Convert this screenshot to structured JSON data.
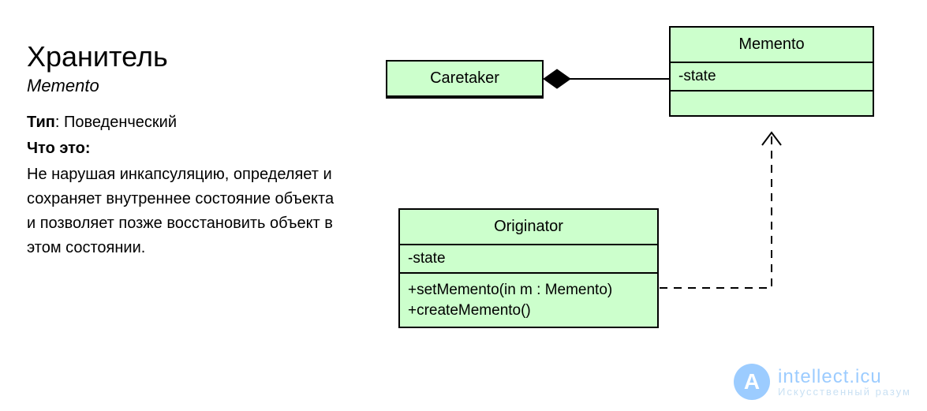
{
  "text": {
    "title": "Хранитель",
    "subtitle": "Memento",
    "type_label": "Тип",
    "type_value": "Поведенческий",
    "what_label": "Что это",
    "description": "Не нарушая инкапсуляцию, определяет и сохраняет внутреннее состояние объекта и позволяет позже восстановить объект в этом состоя­нии."
  },
  "uml": {
    "caretaker": {
      "name": "Caretaker",
      "attributes": [],
      "operations": []
    },
    "memento": {
      "name": "Memento",
      "attributes": [
        "-state"
      ],
      "operations": []
    },
    "originator": {
      "name": "Originator",
      "attributes": [
        "-state"
      ],
      "operations": [
        "+setMemento(in m : Memento)",
        "+createMemento()"
      ]
    },
    "relations": {
      "caretaker_memento": "aggregation",
      "originator_memento": "dependency"
    }
  },
  "watermark": {
    "badge": "A",
    "main": "intellect.icu",
    "sub": "Искусственный разум"
  }
}
